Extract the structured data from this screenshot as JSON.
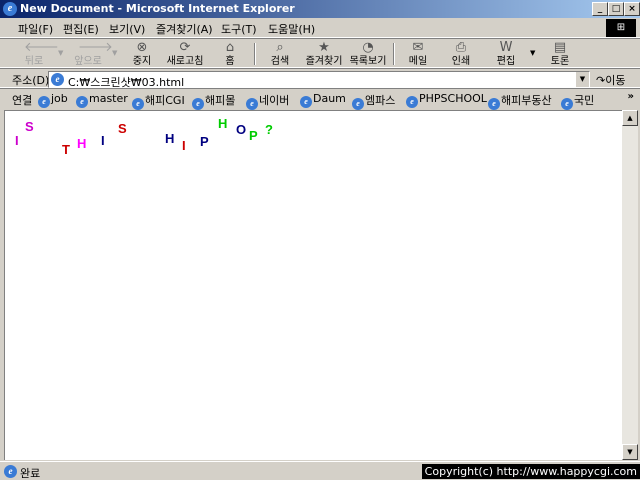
{
  "window": {
    "title": "New Document - Microsoft Internet Explorer",
    "minimize": "_",
    "maximize": "□",
    "close": "×"
  },
  "menu": [
    "파일(F)",
    "편집(E)",
    "보기(V)",
    "즐겨찾기(A)",
    "도구(T)",
    "도움말(H)"
  ],
  "toolbar": {
    "back": "뒤로",
    "forward": "앞으로",
    "stop": "중지",
    "refresh": "새로고침",
    "home": "홈",
    "search": "검색",
    "favorites": "즐겨찾기",
    "history": "목록보기",
    "mail": "메일",
    "print": "인쇄",
    "edit": "편집",
    "discuss": "토론"
  },
  "address": {
    "label": "주소(D)",
    "value": "C:₩스크린샷₩03.html",
    "go": "이동"
  },
  "links": {
    "label": "연결",
    "items": [
      "job",
      "master",
      "해피CGI",
      "해피몰",
      "네이버",
      "Daum",
      "엠파스",
      "PHPSCHOOL",
      "해피부동산",
      "국민"
    ],
    "more": "»"
  },
  "page": {
    "letters": [
      {
        "char": "I",
        "color": "#cc00cc"
      },
      {
        "char": "S",
        "color": "#cc00cc"
      },
      {
        "char": "T",
        "color": "#cc0000"
      },
      {
        "char": "H",
        "color": "#ff00ff"
      },
      {
        "char": "I",
        "color": "#000080"
      },
      {
        "char": "S",
        "color": "#cc0000"
      },
      {
        "char": "H",
        "color": "#000080"
      },
      {
        "char": "I",
        "color": "#cc0000"
      },
      {
        "char": "P",
        "color": "#000080"
      },
      {
        "char": "H",
        "color": "#00cc00"
      },
      {
        "char": "O",
        "color": "#000080"
      },
      {
        "char": "P",
        "color": "#00cc00"
      },
      {
        "char": "?",
        "color": "#00cc00"
      }
    ]
  },
  "status": {
    "text": "완료",
    "copyright": "Copyright(c) http://www.happycgi.com"
  }
}
